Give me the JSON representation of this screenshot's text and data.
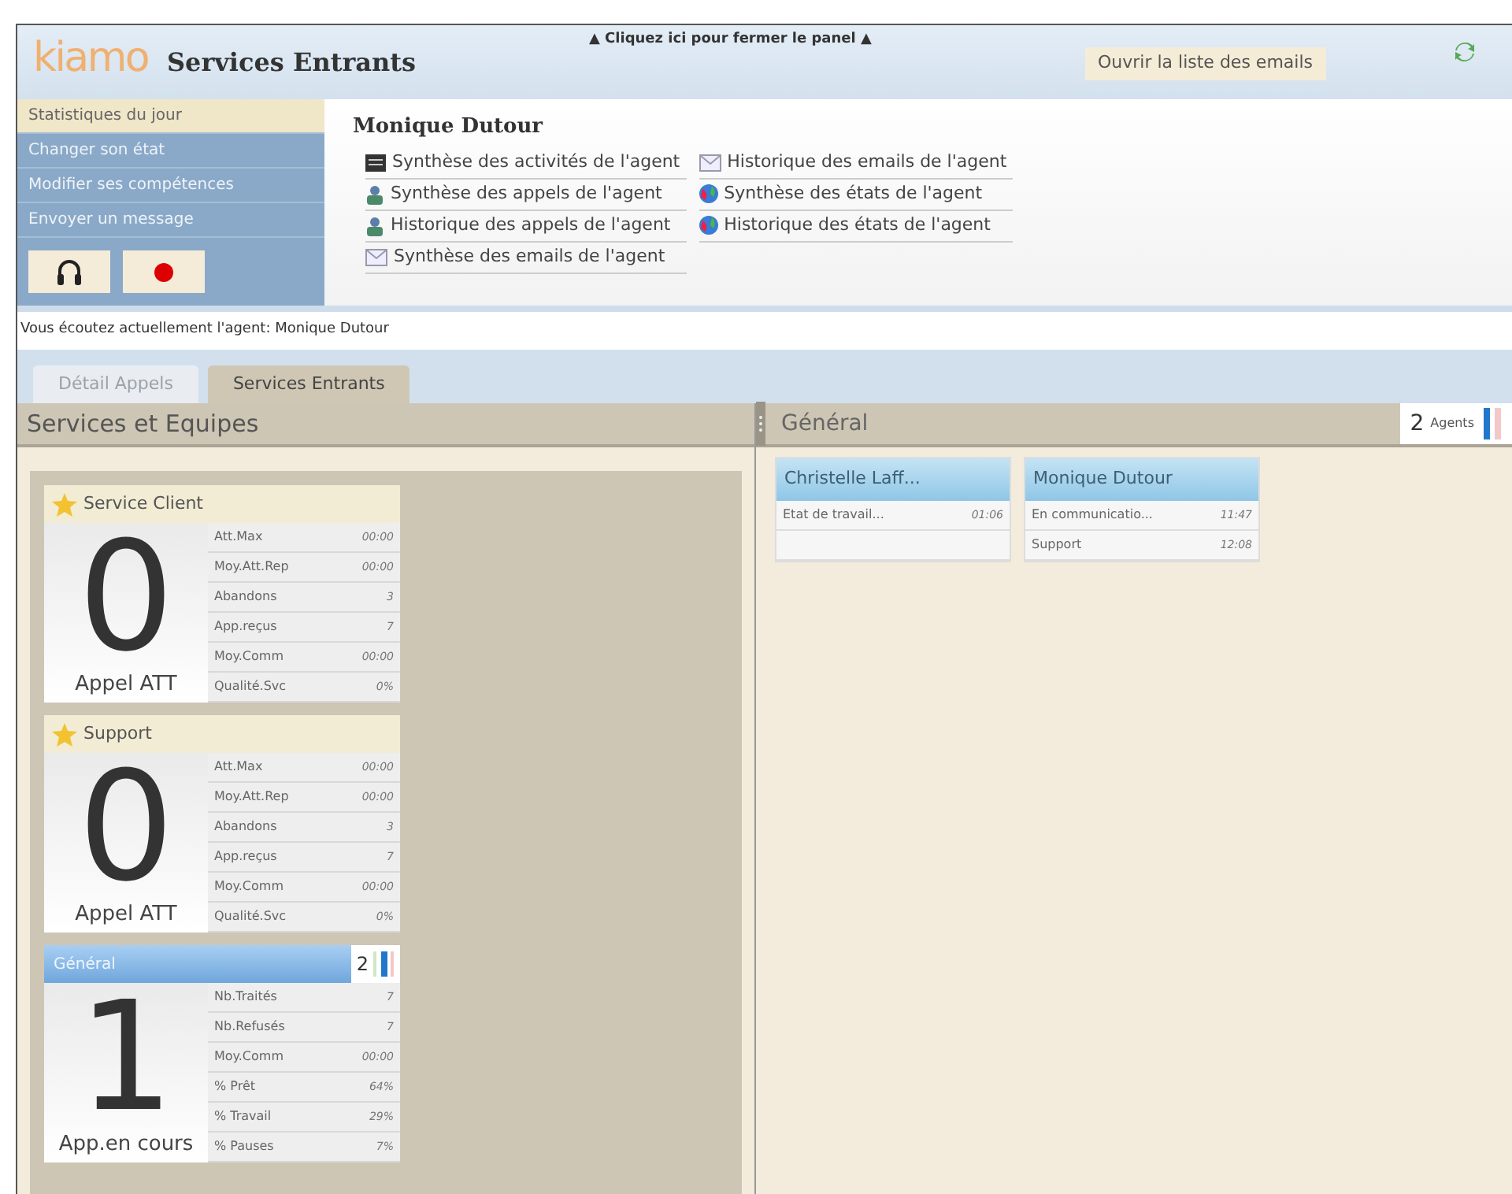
{
  "header": {
    "logo": "kiamo",
    "title": "Services Entrants",
    "close_panel": "▲ Cliquez ici pour fermer le panel ▲",
    "email_button": "Ouvrir la liste des emails"
  },
  "sidebar": {
    "items": [
      {
        "label": "Statistiques du jour",
        "selected": true
      },
      {
        "label": "Changer son état",
        "selected": false
      },
      {
        "label": "Modifier ses compétences",
        "selected": false
      },
      {
        "label": "Envoyer un message",
        "selected": false
      }
    ],
    "buttons": [
      {
        "kind": "headset"
      },
      {
        "kind": "record"
      }
    ]
  },
  "agent_panel": {
    "name": "Monique Dutour",
    "columns": [
      [
        {
          "label": "Synthèse des activités de l'agent",
          "kind": "report"
        },
        {
          "label": "Synthèse des appels de l'agent",
          "kind": "phone"
        },
        {
          "label": "Historique des appels de l'agent",
          "kind": "phone"
        },
        {
          "label": "Synthèse des emails de l'agent",
          "kind": "mail"
        }
      ],
      [
        {
          "label": "Historique des emails de l'agent",
          "kind": "mail"
        },
        {
          "label": "Synthèse des états de l'agent",
          "kind": "globe"
        },
        {
          "label": "Historique des états de l'agent",
          "kind": "globe"
        }
      ]
    ]
  },
  "status": "Vous écoutez actuellement l'agent: Monique Dutour",
  "tabs": [
    {
      "label": "Détail Appels",
      "selected": false,
      "disabled": true
    },
    {
      "label": "Services Entrants",
      "selected": true,
      "disabled": false
    }
  ],
  "left_panel": {
    "title": "Services et Equipes",
    "cards": [
      {
        "kind": "service",
        "name": "Service Client",
        "count": "0",
        "caption": "Appel ATT",
        "stats": [
          {
            "label": "Att.Max",
            "value": "00:00"
          },
          {
            "label": "Moy.Att.Rep",
            "value": "00:00"
          },
          {
            "label": "Abandons",
            "value": "3"
          },
          {
            "label": "App.reçus",
            "value": "7"
          },
          {
            "label": "Moy.Comm",
            "value": "00:00"
          },
          {
            "label": "Qualité.Svc",
            "value": "0%"
          }
        ]
      },
      {
        "kind": "service",
        "name": "Support",
        "count": "0",
        "caption": "Appel ATT",
        "stats": [
          {
            "label": "Att.Max",
            "value": "00:00"
          },
          {
            "label": "Moy.Att.Rep",
            "value": "00:00"
          },
          {
            "label": "Abandons",
            "value": "3"
          },
          {
            "label": "App.reçus",
            "value": "7"
          },
          {
            "label": "Moy.Comm",
            "value": "00:00"
          },
          {
            "label": "Qualité.Svc",
            "value": "0%"
          }
        ]
      },
      {
        "kind": "group",
        "name": "Général",
        "agents": "2",
        "count": "1",
        "caption": "App.en cours",
        "stats": [
          {
            "label": "Nb.Traités",
            "value": "7"
          },
          {
            "label": "Nb.Refusés",
            "value": "7"
          },
          {
            "label": "Moy.Comm",
            "value": "00:00"
          },
          {
            "label": "% Prêt",
            "value": "64%"
          },
          {
            "label": "% Travail",
            "value": "29%"
          },
          {
            "label": "% Pauses",
            "value": "7%"
          }
        ]
      }
    ]
  },
  "right_panel": {
    "title": "Général",
    "agent_count": "2",
    "agent_label": "Agents",
    "agents": [
      {
        "name": "Christelle Laff...",
        "rows": [
          {
            "label": "Etat de travail...",
            "value": "01:06"
          }
        ]
      },
      {
        "name": "Monique Dutour",
        "rows": [
          {
            "label": "En communicatio...",
            "value": "11:47"
          },
          {
            "label": "Support",
            "value": "12:08"
          }
        ]
      }
    ]
  }
}
